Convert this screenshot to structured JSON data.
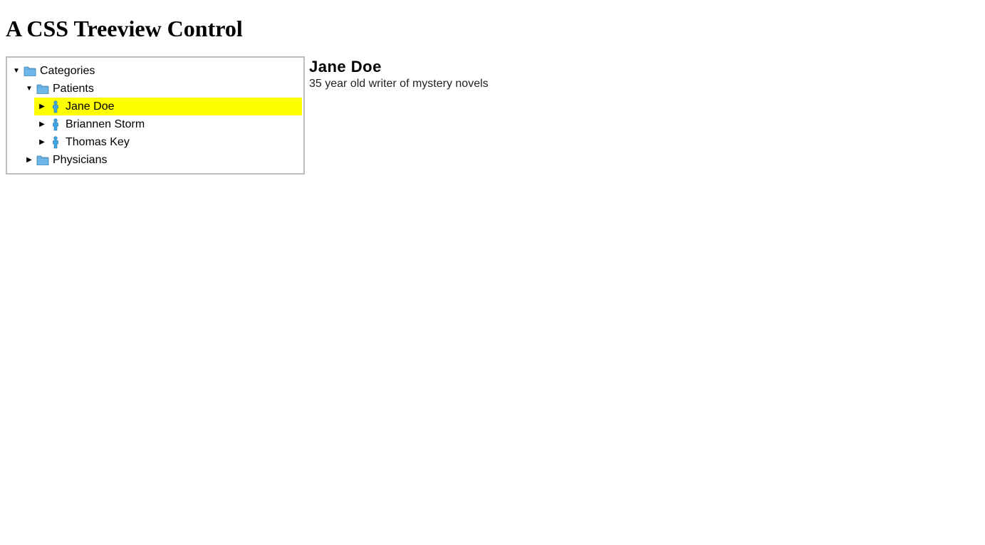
{
  "page": {
    "title": "A CSS Treeview Control"
  },
  "tree": {
    "root": {
      "label": "Categories",
      "icon": "folder",
      "expanded": true,
      "children": [
        {
          "label": "Patients",
          "icon": "folder",
          "expanded": true,
          "children": [
            {
              "label": "Jane Doe",
              "icon": "person",
              "expanded": false,
              "selected": true
            },
            {
              "label": "Briannen Storm",
              "icon": "person",
              "expanded": false
            },
            {
              "label": "Thomas Key",
              "icon": "person",
              "expanded": false
            }
          ]
        },
        {
          "label": "Physicians",
          "icon": "folder",
          "expanded": false
        }
      ]
    }
  },
  "detail": {
    "title": "Jane Doe",
    "description": "35 year old writer of mystery novels"
  },
  "glyphs": {
    "expanded": "▼",
    "collapsed": "▶"
  },
  "colors": {
    "selection": "#ffff00",
    "border": "#bdbdbd",
    "folder_fill": "#6fb7e9",
    "folder_stroke": "#3a7ca8",
    "person_fill": "#3fa7e4",
    "person_stroke": "#1f6fa8"
  }
}
